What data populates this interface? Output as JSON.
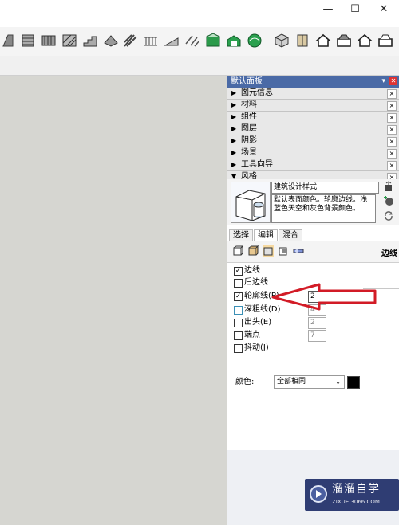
{
  "window": {
    "minimize_glyph": "—",
    "maximize_glyph": "☐",
    "close_glyph": "✕"
  },
  "panel": {
    "title": "默认面板",
    "pin_glyph": "▾",
    "close_glyph": "✕",
    "trays": [
      {
        "label": "图元信息",
        "expanded": false
      },
      {
        "label": "材料",
        "expanded": false
      },
      {
        "label": "组件",
        "expanded": false
      },
      {
        "label": "图层",
        "expanded": false
      },
      {
        "label": "阴影",
        "expanded": false
      },
      {
        "label": "场景",
        "expanded": false
      },
      {
        "label": "工具向导",
        "expanded": false
      },
      {
        "label": "风格",
        "expanded": true
      }
    ],
    "collapsed_arrow": "▶",
    "expanded_arrow": "▼",
    "tray_close_glyph": "×"
  },
  "styles": {
    "name": "建筑设计样式",
    "description": "默认表面颜色。轮廓边线。浅蓝色天空和灰色背景颜色。",
    "tabs": [
      {
        "label": "选择",
        "active": false
      },
      {
        "label": "编辑",
        "active": true
      },
      {
        "label": "混合",
        "active": false
      }
    ],
    "edit_section_title": "边线",
    "options": [
      {
        "label": "边线",
        "checked": true,
        "value": null
      },
      {
        "label": "后边线",
        "checked": false,
        "value": null
      },
      {
        "label": "轮廓线(P)",
        "checked": true,
        "value": "2"
      },
      {
        "label": "深粗线(D)",
        "checked": false,
        "value": "4"
      },
      {
        "label": "出头(E)",
        "checked": false,
        "value": "2"
      },
      {
        "label": "端点",
        "checked": false,
        "value": "7"
      },
      {
        "label": "抖动(J)",
        "checked": false,
        "value": null
      }
    ],
    "color_label": "颜色:",
    "color_select": "全部相同",
    "color_swatch": "#000000"
  },
  "watermark": {
    "title": "溜溜自学",
    "url": "ZIXUE.3066.COM"
  },
  "colors": {
    "panel_title_bg": "#4a6aa6",
    "annotation_arrow": "#d21b26",
    "viewport_bg": "#d6d6d1"
  }
}
